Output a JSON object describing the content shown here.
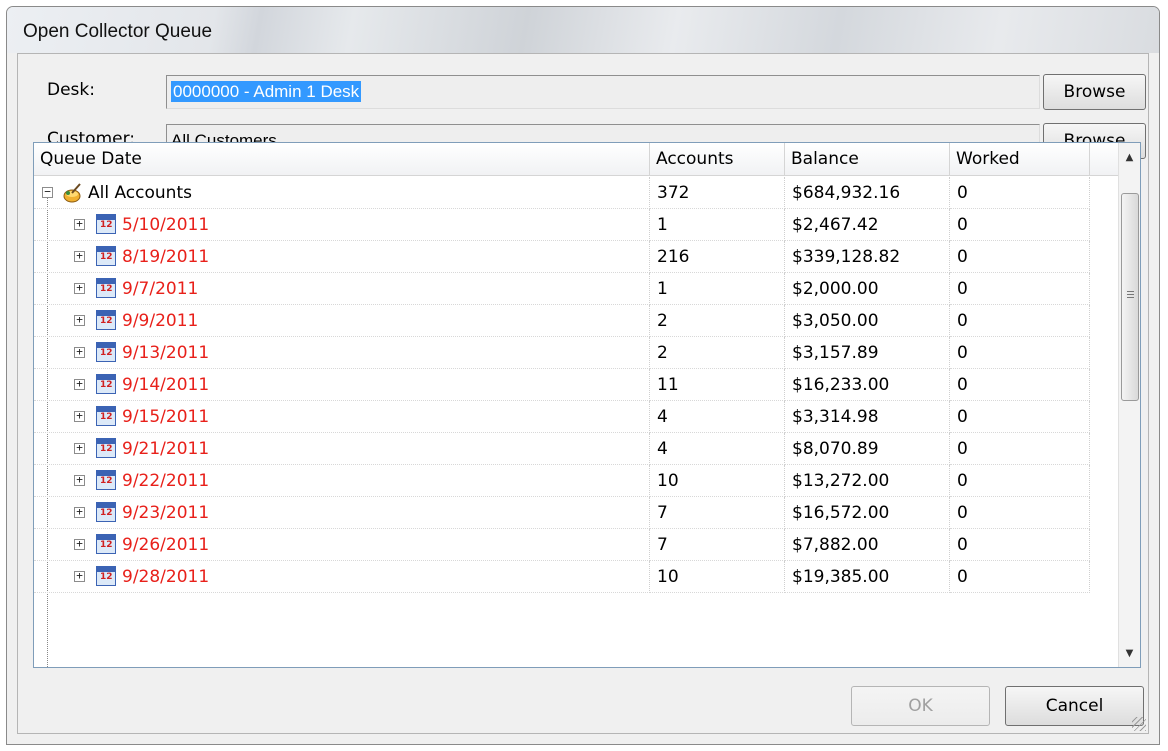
{
  "window": {
    "title": "Open Collector Queue"
  },
  "form": {
    "desk_label": "Desk:",
    "desk_value": "0000000 - Admin 1 Desk",
    "customer_label": "Customer:",
    "customer_value": "All Customers",
    "browse_label": "Browse"
  },
  "grid": {
    "columns": [
      "Queue Date",
      "Accounts",
      "Balance",
      "Worked"
    ],
    "root": {
      "label": "All Accounts",
      "accounts": "372",
      "balance": "$684,932.16",
      "worked": "0",
      "icon": "queue-root-icon"
    },
    "rows": [
      {
        "date": "5/10/2011",
        "accounts": "1",
        "balance": "$2,467.42",
        "worked": "0"
      },
      {
        "date": "8/19/2011",
        "accounts": "216",
        "balance": "$339,128.82",
        "worked": "0"
      },
      {
        "date": "9/7/2011",
        "accounts": "1",
        "balance": "$2,000.00",
        "worked": "0"
      },
      {
        "date": "9/9/2011",
        "accounts": "2",
        "balance": "$3,050.00",
        "worked": "0"
      },
      {
        "date": "9/13/2011",
        "accounts": "2",
        "balance": "$3,157.89",
        "worked": "0"
      },
      {
        "date": "9/14/2011",
        "accounts": "11",
        "balance": "$16,233.00",
        "worked": "0"
      },
      {
        "date": "9/15/2011",
        "accounts": "4",
        "balance": "$3,314.98",
        "worked": "0"
      },
      {
        "date": "9/21/2011",
        "accounts": "4",
        "balance": "$8,070.89",
        "worked": "0"
      },
      {
        "date": "9/22/2011",
        "accounts": "10",
        "balance": "$13,272.00",
        "worked": "0"
      },
      {
        "date": "9/23/2011",
        "accounts": "7",
        "balance": "$16,572.00",
        "worked": "0"
      },
      {
        "date": "9/26/2011",
        "accounts": "7",
        "balance": "$7,882.00",
        "worked": "0"
      },
      {
        "date": "9/28/2011",
        "accounts": "10",
        "balance": "$19,385.00",
        "worked": "0"
      }
    ],
    "calendar_icon_text": "12",
    "date_color": "#e8201a"
  },
  "footer": {
    "ok_label": "OK",
    "cancel_label": "Cancel"
  }
}
